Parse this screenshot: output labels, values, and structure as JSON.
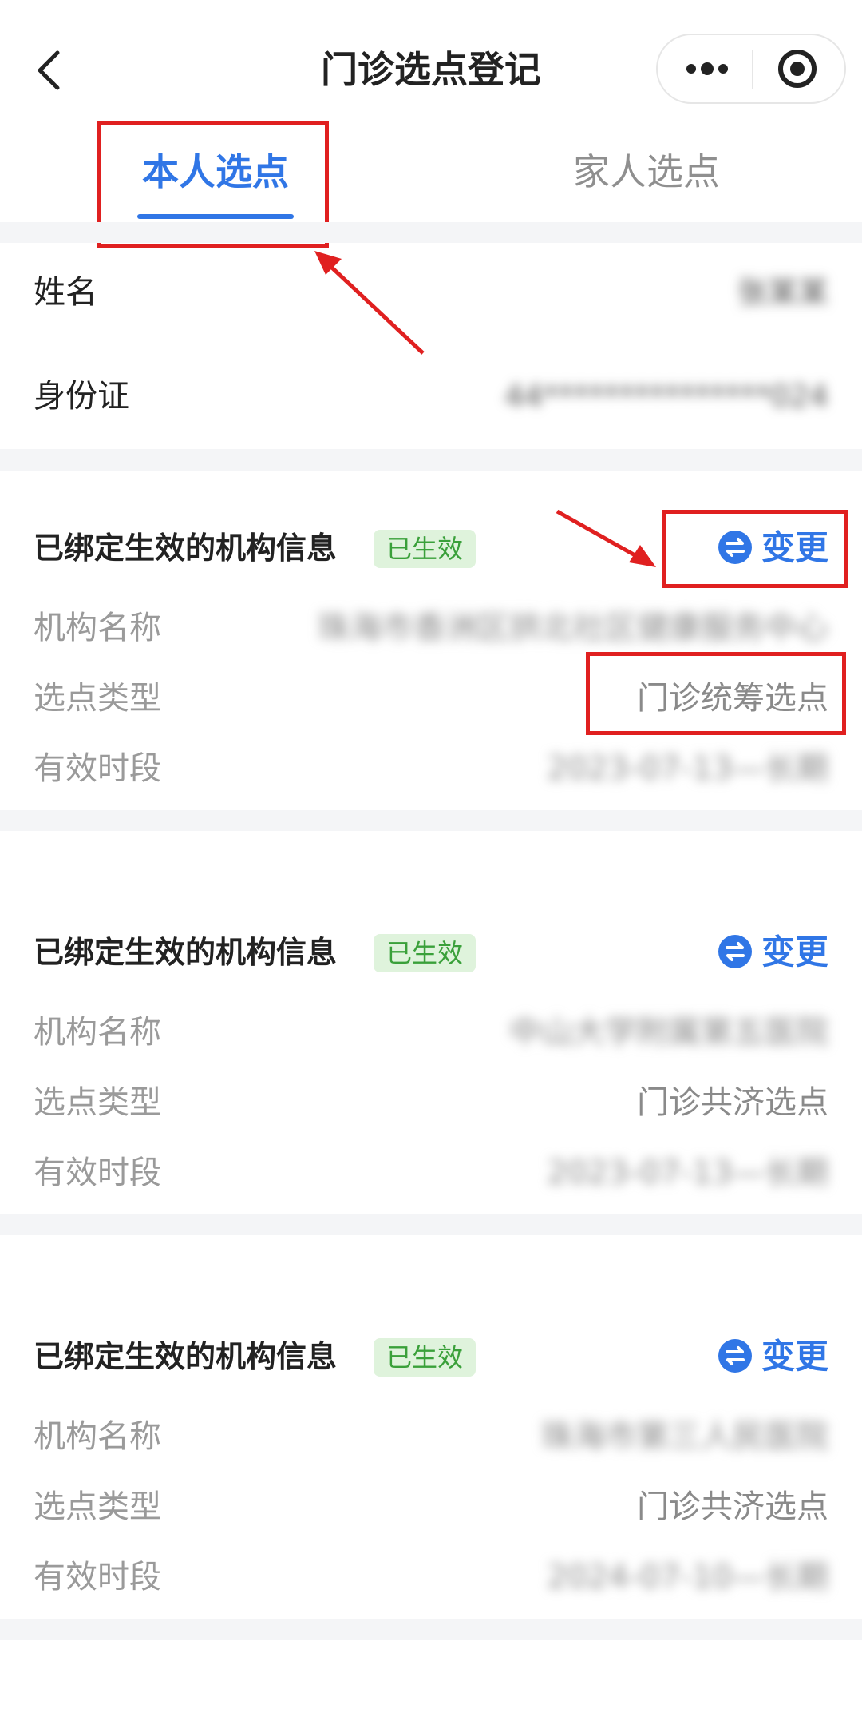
{
  "header": {
    "title": "门诊选点登记",
    "back_icon": "chevron-left-icon",
    "more_icon": "more-dots-icon",
    "target_icon": "target-icon"
  },
  "tabs": [
    {
      "label": "本人选点",
      "active": true
    },
    {
      "label": "家人选点",
      "active": false
    }
  ],
  "person": {
    "name_label": "姓名",
    "name_value": "张某某",
    "id_label": "身份证",
    "id_value": "44***************024"
  },
  "cards": [
    {
      "title": "已绑定生效的机构信息",
      "badge": "已生效",
      "change_label": "变更",
      "fields": [
        {
          "label": "机构名称",
          "value": "珠海市香洲区拱北社区健康服务中心",
          "blurred": true
        },
        {
          "label": "选点类型",
          "value": "门诊统筹选点",
          "blurred": false
        },
        {
          "label": "有效时段",
          "value": "2023-07-13—长期",
          "blurred": true
        }
      ]
    },
    {
      "title": "已绑定生效的机构信息",
      "badge": "已生效",
      "change_label": "变更",
      "fields": [
        {
          "label": "机构名称",
          "value": "中山大学附属第五医院",
          "blurred": true
        },
        {
          "label": "选点类型",
          "value": "门诊共济选点",
          "blurred": false
        },
        {
          "label": "有效时段",
          "value": "2023-07-13—长期",
          "blurred": true
        }
      ]
    },
    {
      "title": "已绑定生效的机构信息",
      "badge": "已生效",
      "change_label": "变更",
      "fields": [
        {
          "label": "机构名称",
          "value": "珠海市第三人民医院",
          "blurred": true
        },
        {
          "label": "选点类型",
          "value": "门诊共济选点",
          "blurred": false
        },
        {
          "label": "有效时段",
          "value": "2024-07-10—长期",
          "blurred": true
        }
      ]
    }
  ],
  "colors": {
    "accent": "#3076e6",
    "badge_bg": "#dff3dc",
    "badge_text": "#3aa03a",
    "annotation_red": "#e02020"
  }
}
